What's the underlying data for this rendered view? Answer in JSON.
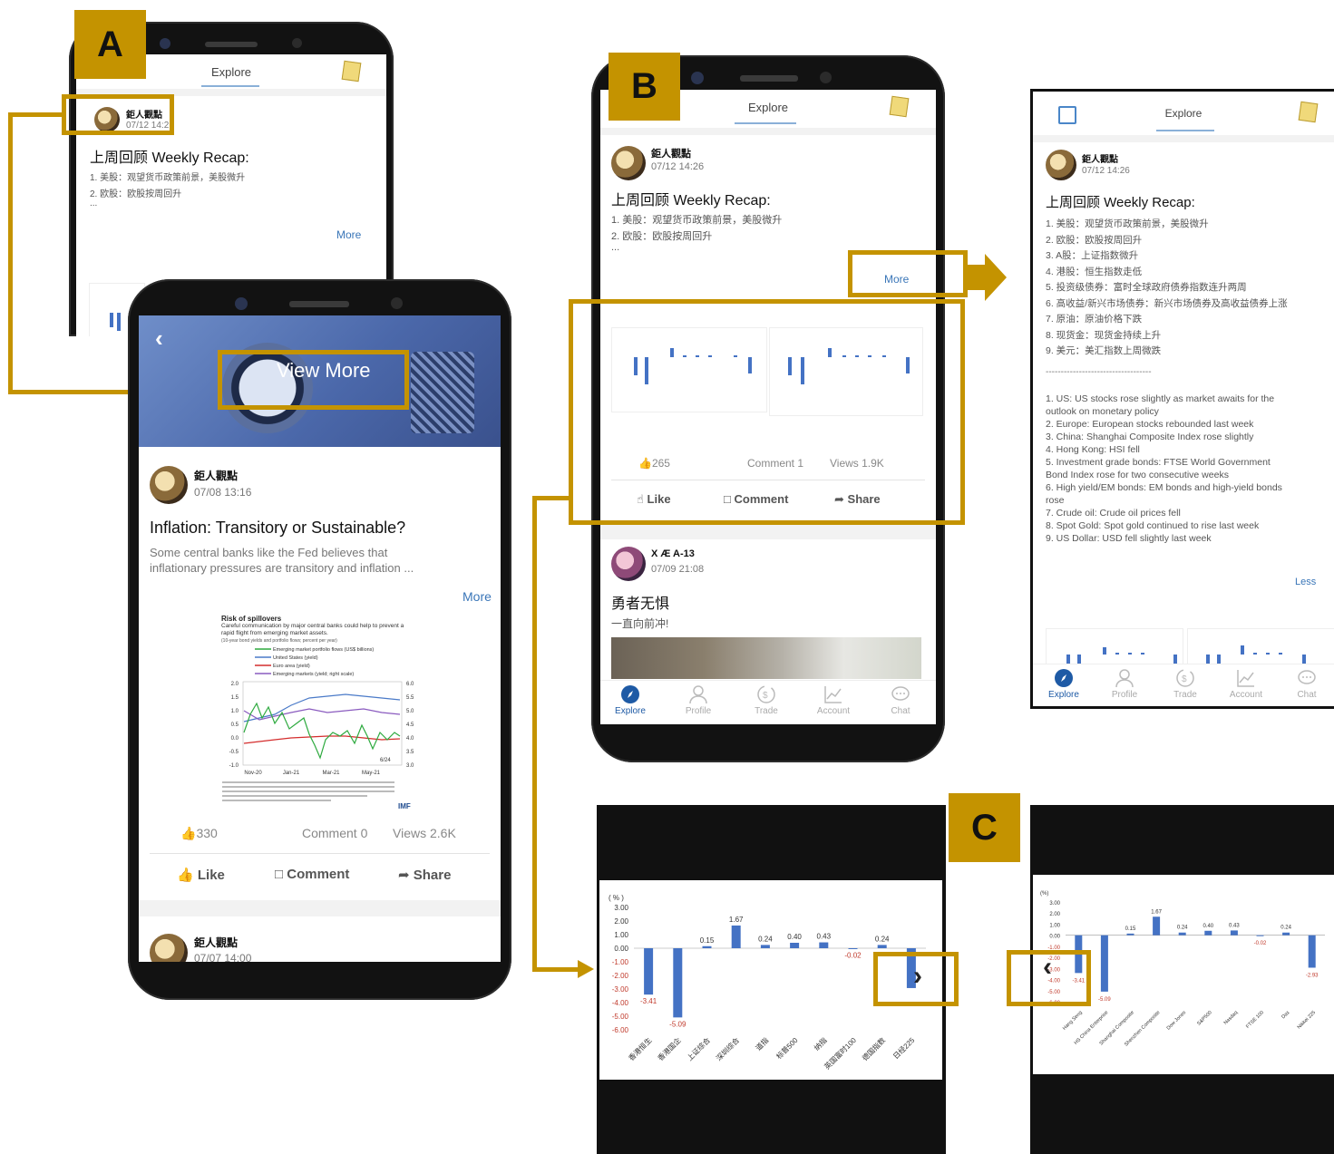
{
  "labels": {
    "a": "A",
    "b": "B",
    "c": "C"
  },
  "tab_title": "Explore",
  "post1": {
    "author": "鉅人觀點",
    "time": "07/12 14:26",
    "time_truncated": "07/12 14:2",
    "title": "上周回顾 Weekly Recap:",
    "lines": [
      "1. 美股：观望货币政策前景，美股微升",
      "2. 欧股：欧股按周回升"
    ],
    "ellipsis": "...",
    "more": "More",
    "likes": "265",
    "comments": "Comment 1",
    "views": "Views 1.9K"
  },
  "expanded": {
    "lines_cn": [
      "1. 美股：观望货币政策前景，美股微升",
      "2. 欧股：欧股按周回升",
      "3. A股：上证指数微升",
      "4. 港股：恒生指数走低",
      "5. 投资级债券：富时全球政府债券指数连升两周",
      "6. 高收益/新兴市场债券：新兴市场债券及高收益债券上涨",
      "7. 原油：原油价格下跌",
      "8. 现货金：现货金持续上升",
      "9. 美元：美汇指数上周微跌"
    ],
    "divider": "-----------------------------------",
    "lines_en": [
      "1. US: US stocks rose slightly as market awaits for the",
      "outlook on monetary policy",
      "2. Europe: European stocks rebounded last week",
      "3. China: Shanghai Composite Index rose slightly",
      "4. Hong Kong: HSI fell",
      "5. Investment grade bonds: FTSE World Government",
      "Bond Index rose for two consecutive weeks",
      "6. High yield/EM bonds: EM bonds and high-yield bonds",
      "rose",
      "7. Crude oil: Crude oil prices fell",
      "8. Spot Gold: Spot gold continued to rise last week",
      "9. US Dollar: USD fell slightly last week"
    ],
    "less": "Less"
  },
  "post2": {
    "banner_text": "View More",
    "author": "鉅人觀點",
    "time": "07/08 13:16",
    "title": "Inflation: Transitory or Sustainable?",
    "lines": [
      "Some central banks like the Fed believes that",
      "inflationary pressures are transitory and inflation ..."
    ],
    "more": "More",
    "figure": {
      "title": "Risk of spillovers",
      "subtitle": "Careful communication by major central banks could help to prevent a rapid flight from emerging market assets.",
      "note": "(10-year bond yields and portfolio flows; percent per year)",
      "legend": [
        "Emerging market portfolio flows (US$ billions)",
        "United States (yield)",
        "Euro area (yield)",
        "Emerging markets (yield; right scale)"
      ],
      "left_ticks": [
        "2.0",
        "1.5",
        "1.0",
        "0.5",
        "0.0",
        "-0.5",
        "-1.0"
      ],
      "right_ticks": [
        "6.0",
        "5.5",
        "5.0",
        "4.5",
        "4.0",
        "3.5",
        "3.0"
      ],
      "x_ticks": [
        "Nov-20",
        "Jan-21",
        "Mar-21",
        "May-21"
      ],
      "date_mark": "6/24",
      "source": "IMF"
    },
    "likes": "330",
    "comments": "Comment 0",
    "views": "Views 2.6K"
  },
  "post3": {
    "author": "鉅人觀點",
    "time": "07/07 14:00"
  },
  "post4": {
    "author": "X Æ A-13",
    "time": "07/09 21:08",
    "title": "勇者无惧",
    "body": "一直向前冲!"
  },
  "actions": {
    "like": "Like",
    "comment": "Comment",
    "share": "Share"
  },
  "nav": [
    {
      "label": "Explore",
      "icon": "compass-icon"
    },
    {
      "label": "Profile",
      "icon": "person-icon"
    },
    {
      "label": "Trade",
      "icon": "exchange-icon"
    },
    {
      "label": "Account",
      "icon": "line-chart-icon"
    },
    {
      "label": "Chat",
      "icon": "chat-bubble-icon"
    }
  ],
  "chart_data": [
    {
      "type": "bar",
      "ylabel": "( % )",
      "categories": [
        "香港恒生",
        "香港国企",
        "上证综合",
        "深圳综合",
        "道指",
        "标普500",
        "纳指",
        "英国富时100",
        "德国指数",
        "日经225"
      ],
      "values": [
        -3.41,
        -5.09,
        0.15,
        1.67,
        0.24,
        0.4,
        0.43,
        -0.02,
        0.24,
        -2.93
      ],
      "value_labels": [
        "-3.41",
        "-5.09",
        "0.15",
        "1.67",
        "0.24",
        "0.40",
        "0.43",
        "-0.02",
        "0.24",
        ""
      ],
      "yticks": [
        "3.00",
        "2.00",
        "1.00",
        "0.00",
        "-1.00",
        "-2.00",
        "-3.00",
        "-4.00",
        "-5.00",
        "-6.00"
      ],
      "ylim": [
        -6,
        3
      ],
      "colors": {
        "bar": "#4472c4",
        "negative_label": "#c0392b",
        "positive_label": "#333333"
      }
    },
    {
      "type": "bar",
      "ylabel": "(%)",
      "categories": [
        "Hang Seng",
        "HS China Enterprise",
        "Shanghai Composite",
        "Shenzhen Composite",
        "Dow Jones",
        "S&P500",
        "Nasdaq",
        "FTSE 100",
        "Dax",
        "Nikkei 225"
      ],
      "values": [
        -3.41,
        -5.09,
        0.15,
        1.67,
        0.24,
        0.4,
        0.43,
        -0.02,
        0.24,
        -2.93
      ],
      "value_labels": [
        "-3.41",
        "-5.09",
        "0.15",
        "1.67",
        "0.24",
        "0.40",
        "0.43",
        "-0.02",
        "0.24",
        "-2.93"
      ],
      "yticks": [
        "3.00",
        "2.00",
        "1.00",
        "0.00",
        "-1.00",
        "-2.00",
        "-3.00",
        "-4.00",
        "-5.00",
        "-6.00"
      ],
      "ylim": [
        -6,
        3
      ]
    }
  ]
}
